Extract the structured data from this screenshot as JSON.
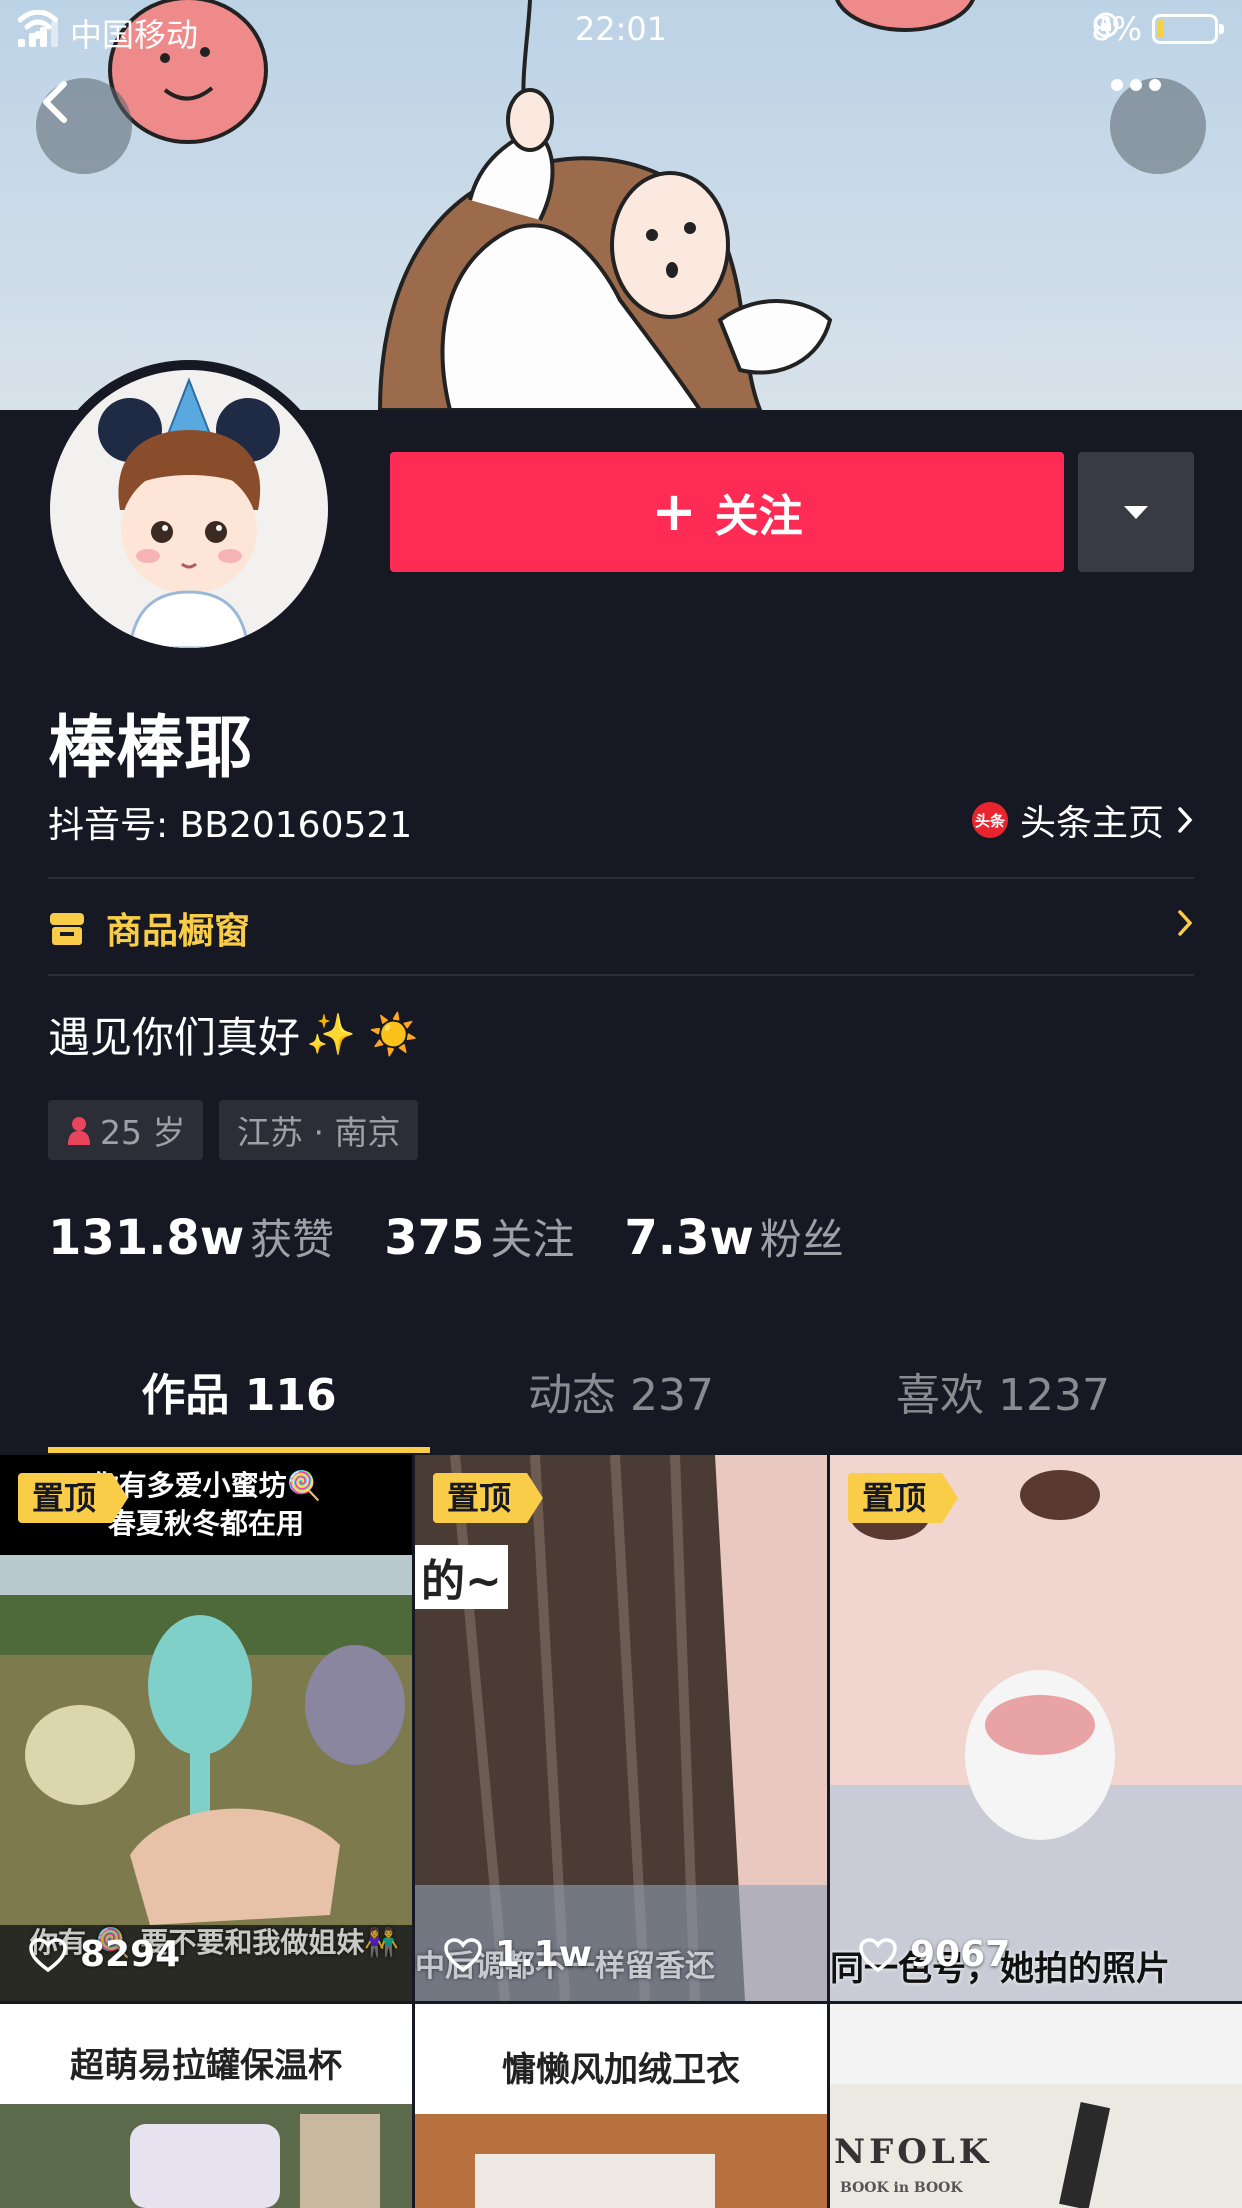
{
  "status_bar": {
    "carrier": "中国移动",
    "time": "22:01",
    "battery": "8%"
  },
  "header": {
    "back_icon": "chevron-left-icon",
    "more_icon": "ellipsis-icon"
  },
  "profile": {
    "follow_label": "关注",
    "follow_plus": "+",
    "username": "棒棒耶",
    "douyin_id": "抖音号: BB20160521",
    "toutiao_badge": "头条",
    "toutiao_label": "头条主页",
    "shop_label": "商品橱窗",
    "bio": "遇见你们真好",
    "bio_emoji": "✨ ☀️",
    "age": "25 岁",
    "location": "江苏 · 南京"
  },
  "stats": [
    {
      "value": "131.8w",
      "label": "获赞"
    },
    {
      "value": "375",
      "label": "关注"
    },
    {
      "value": "7.3w",
      "label": "粉丝"
    }
  ],
  "tabs": [
    {
      "label": "作品 116",
      "active": true
    },
    {
      "label": "动态 237",
      "active": false
    },
    {
      "label": "喜欢 1237",
      "active": false
    }
  ],
  "videos": [
    {
      "pinned": "置顶",
      "likes": "8294",
      "top_caption": "你有多爱小蜜坊🍭\n春夏秋冬都在用",
      "bottom_caption": "你有 🍭 要不要和我做姐妹👫"
    },
    {
      "pinned": "置顶",
      "likes": "1.1w",
      "top_caption": "的~",
      "bottom_caption": "中后调都不一样留香还"
    },
    {
      "pinned": "置顶",
      "likes": "9067",
      "bottom_caption": "同一色号，她拍的照片"
    },
    {
      "top_caption": "超萌易拉罐保温杯"
    },
    {
      "top_caption": "慵懒风加绒卫衣"
    },
    {
      "top_caption": "NFOLK",
      "sub_caption": "BOOK in BOOK"
    }
  ],
  "colors": {
    "accent": "#fe2c55",
    "highlight": "#facd48",
    "background": "#161823"
  }
}
